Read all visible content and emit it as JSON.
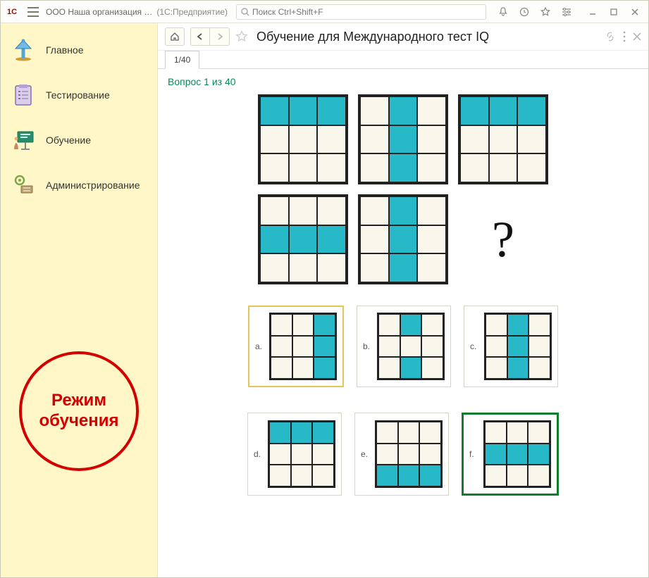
{
  "titlebar": {
    "org": "ООО Наша организация …",
    "sub": "(1С:Предприятие)",
    "search_placeholder": "Поиск Ctrl+Shift+F"
  },
  "sidebar": {
    "items": [
      {
        "label": "Главное"
      },
      {
        "label": "Тестирование"
      },
      {
        "label": "Обучение"
      },
      {
        "label": "Администрирование"
      }
    ],
    "training_mode": "Режим обучения"
  },
  "toolbar": {
    "title": "Обучение для Международного тест IQ"
  },
  "tabs": {
    "current": "1/40"
  },
  "question": {
    "label": "Вопрос 1 из 40",
    "puzzle_top": [
      [
        1,
        1,
        1,
        0,
        0,
        0,
        0,
        0,
        0
      ],
      [
        0,
        1,
        0,
        0,
        1,
        0,
        0,
        1,
        0
      ],
      [
        1,
        1,
        1,
        0,
        0,
        0,
        0,
        0,
        0
      ]
    ],
    "puzzle_bottom": [
      [
        0,
        0,
        0,
        1,
        1,
        1,
        0,
        0,
        0
      ],
      [
        0,
        1,
        0,
        0,
        1,
        0,
        0,
        1,
        0
      ]
    ],
    "answers": [
      {
        "letter": "a.",
        "cells": [
          0,
          0,
          1,
          0,
          0,
          1,
          0,
          0,
          1
        ],
        "highlight": "yellow"
      },
      {
        "letter": "b.",
        "cells": [
          0,
          1,
          0,
          0,
          0,
          0,
          0,
          1,
          0
        ],
        "highlight": ""
      },
      {
        "letter": "c.",
        "cells": [
          0,
          1,
          0,
          0,
          1,
          0,
          0,
          1,
          0
        ],
        "highlight": ""
      },
      {
        "letter": "d.",
        "cells": [
          1,
          1,
          1,
          0,
          0,
          0,
          0,
          0,
          0
        ],
        "highlight": ""
      },
      {
        "letter": "e.",
        "cells": [
          0,
          0,
          0,
          0,
          0,
          0,
          1,
          1,
          1
        ],
        "highlight": ""
      },
      {
        "letter": "f.",
        "cells": [
          0,
          0,
          0,
          1,
          1,
          1,
          0,
          0,
          0
        ],
        "highlight": "green"
      }
    ]
  },
  "colors": {
    "fill": "#28b9c9",
    "accent_red": "#d20000",
    "accent_green": "#0f7d2d"
  }
}
